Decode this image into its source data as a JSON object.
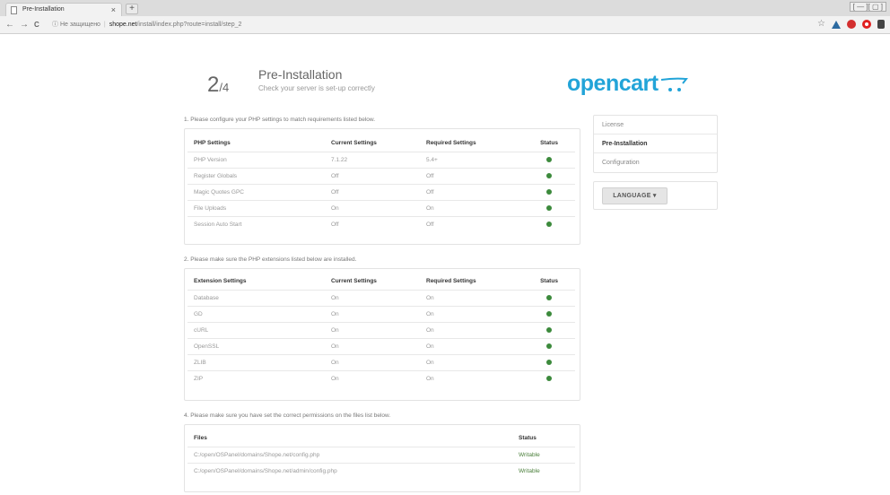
{
  "browser": {
    "tab_title": "Pre-Installation",
    "tab_close": "×",
    "new_tab": "+",
    "window_controls": "[ — ][ ▢ ]",
    "back": "←",
    "forward": "→",
    "reload": "C",
    "security_label": "Не защищено",
    "url_host": "shope.net",
    "url_path": "/install/index.php?route=install/step_2",
    "icons": [
      "star-icon",
      "drive-icon",
      "record-icon",
      "opera-icon",
      "extension-icon"
    ]
  },
  "header": {
    "step_current": "2",
    "step_total": "/4",
    "title": "Pre-Installation",
    "subtitle": "Check your server is set-up correctly",
    "logo_text": "opencart",
    "logo_color": "#22a4d8"
  },
  "section1": {
    "intro": "1. Please configure your PHP settings to match requirements listed below.",
    "headers": [
      "PHP Settings",
      "Current Settings",
      "Required Settings",
      "Status"
    ],
    "rows": [
      [
        "PHP Version",
        "7.1.22",
        "5.4+"
      ],
      [
        "Register Globals",
        "Off",
        "Off"
      ],
      [
        "Magic Quotes GPC",
        "Off",
        "Off"
      ],
      [
        "File Uploads",
        "On",
        "On"
      ],
      [
        "Session Auto Start",
        "Off",
        "Off"
      ]
    ]
  },
  "section2": {
    "intro": "2. Please make sure the PHP extensions listed below are installed.",
    "headers": [
      "Extension Settings",
      "Current Settings",
      "Required Settings",
      "Status"
    ],
    "rows": [
      [
        "Database",
        "On",
        "On"
      ],
      [
        "GD",
        "On",
        "On"
      ],
      [
        "cURL",
        "On",
        "On"
      ],
      [
        "OpenSSL",
        "On",
        "On"
      ],
      [
        "ZLIB",
        "On",
        "On"
      ],
      [
        "ZIP",
        "On",
        "On"
      ]
    ]
  },
  "section4": {
    "intro": "4. Please make sure you have set the correct permissions on the files list below.",
    "headers": [
      "Files",
      "Status"
    ],
    "rows": [
      [
        "C:/open/OSPanel/domains/Shope.net/config.php",
        "Writable"
      ],
      [
        "C:/open/OSPanel/domains/Shope.net/admin/config.php",
        "Writable"
      ]
    ]
  },
  "sidebar": {
    "items": [
      "License",
      "Pre-Installation",
      "Configuration"
    ],
    "active": "Pre-Installation",
    "language_button": "LANGUAGE ▾"
  },
  "colors": {
    "status_ok": "#3c8a3c",
    "writable": "#4a7f3a"
  }
}
